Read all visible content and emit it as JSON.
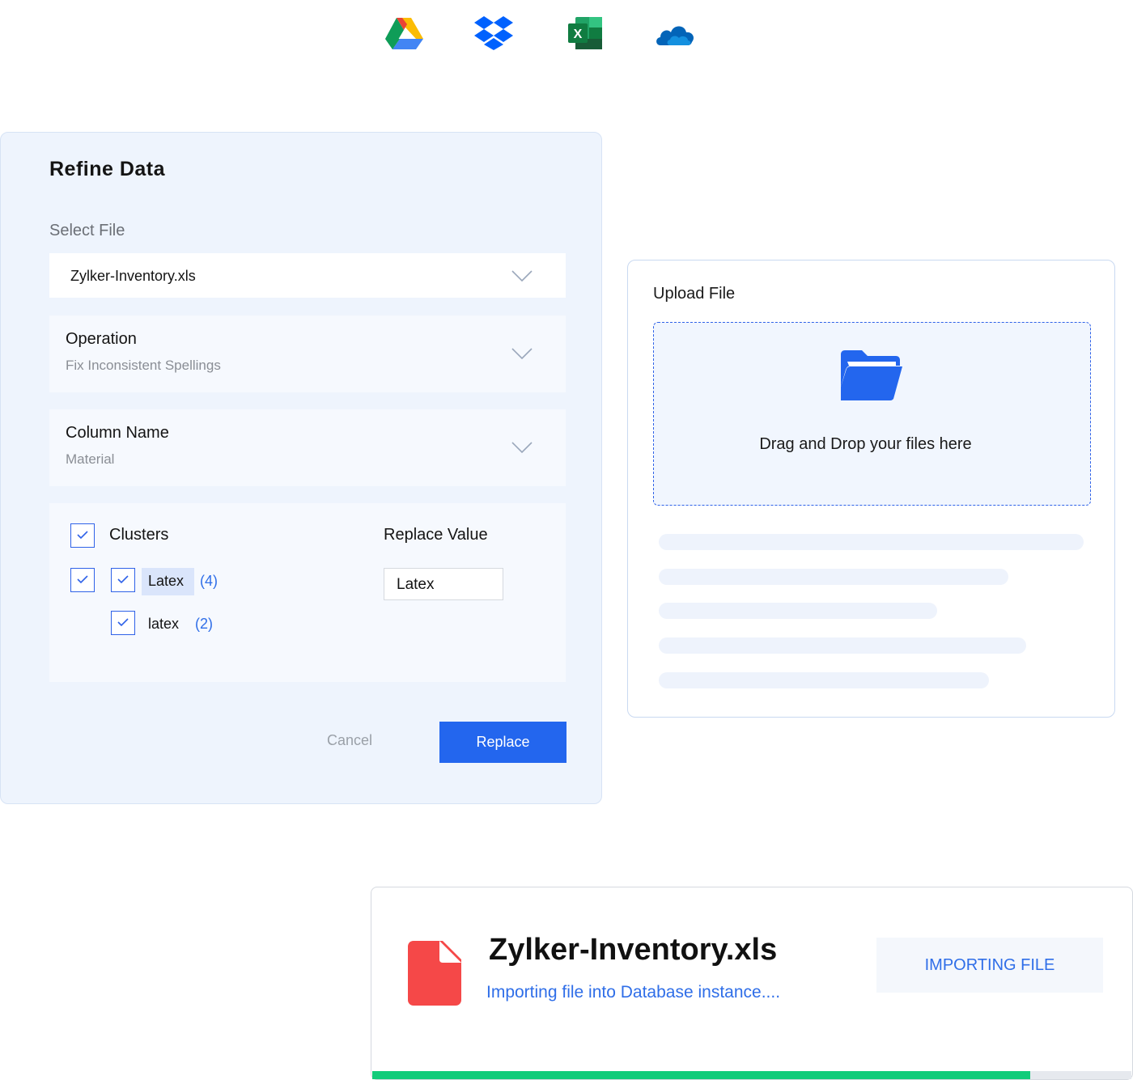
{
  "services": [
    {
      "icon": "google-drive-icon"
    },
    {
      "icon": "dropbox-icon"
    },
    {
      "icon": "excel-icon",
      "letter": "X"
    },
    {
      "icon": "onedrive-icon"
    }
  ],
  "refine": {
    "title": "Refine Data",
    "select_file_label": "Select File",
    "file_value": "Zylker-Inventory.xls",
    "operation": {
      "label": "Operation",
      "value": "Fix Inconsistent Spellings"
    },
    "column": {
      "label": "Column Name",
      "value": "Material"
    },
    "clusters_label": "Clusters",
    "replace_value_label": "Replace Value",
    "cluster_items": [
      {
        "text": "Latex",
        "count": "(4)"
      },
      {
        "text": "latex",
        "count": "(2)"
      }
    ],
    "replace_input_value": "Latex",
    "cancel_label": "Cancel",
    "replace_label": "Replace"
  },
  "upload": {
    "title": "Upload File",
    "drop_text": "Drag and Drop your files here"
  },
  "import": {
    "file_name": "Zylker-Inventory.xls",
    "status_text": "Importing file into Database instance....",
    "badge": "IMPORTING FILE",
    "progress": 0.867
  },
  "colors": {
    "accent": "#2366ee",
    "progress": "#11cc7a",
    "file_icon": "#f54848"
  }
}
